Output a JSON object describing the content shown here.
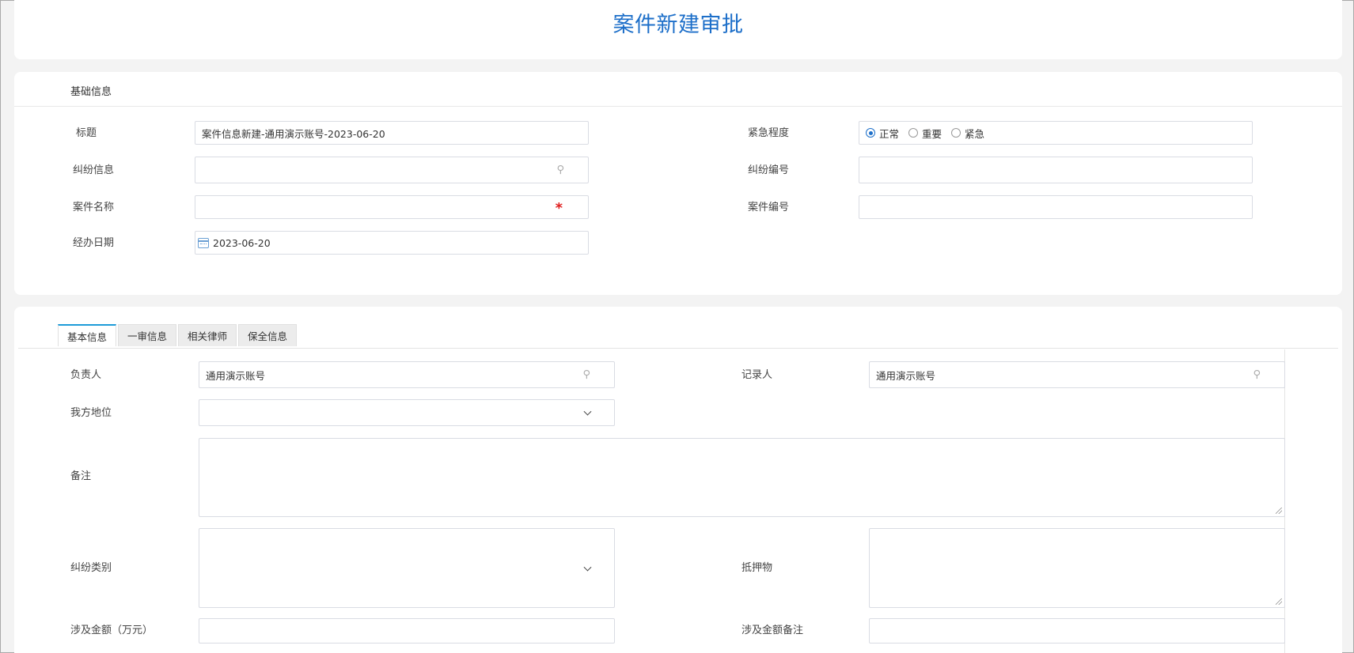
{
  "page": {
    "title": "案件新建审批"
  },
  "basic": {
    "section_title": "基础信息",
    "title_label": "标题",
    "title_value": "案件信息新建-通用演示账号-2023-06-20",
    "urgency_label": "紧急程度",
    "urgency_options": [
      "正常",
      "重要",
      "紧急"
    ],
    "urgency_selected": "正常",
    "dispute_info_label": "纠纷信息",
    "dispute_no_label": "纠纷编号",
    "case_name_label": "案件名称",
    "case_name_required": "*",
    "case_no_label": "案件编号",
    "handle_date_label": "经办日期",
    "handle_date_value": "2023-06-20"
  },
  "tabs": [
    "基本信息",
    "一审信息",
    "相关律师",
    "保全信息"
  ],
  "detail": {
    "owner_label": "负责人",
    "owner_value": "通用演示账号",
    "recorder_label": "记录人",
    "recorder_value": "通用演示账号",
    "our_position_label": "我方地位",
    "remark_label": "备注",
    "dispute_type_label": "纠纷类别",
    "collateral_label": "抵押物",
    "amount_label": "涉及金额（万元）",
    "amount_remark_label": "涉及金额备注"
  },
  "icons": {
    "search": "search-icon",
    "calendar": "calendar-icon",
    "dropdown": "chevron-down-icon"
  },
  "colors": {
    "accent": "#1d6fc9",
    "tab_active": "#1d9bd8",
    "required": "#e02020"
  }
}
